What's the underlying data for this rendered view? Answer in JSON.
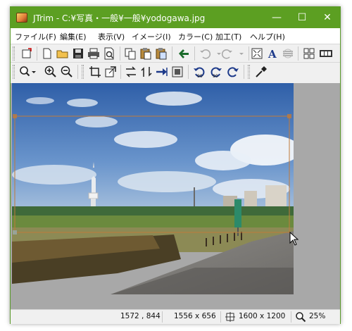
{
  "window": {
    "title": "JTrim - C:¥写真・一般¥一般¥yodogawa.jpg",
    "accent_color": "#5c9f22"
  },
  "title_controls": {
    "minimize": "—",
    "maximize": "☐",
    "close": "✕"
  },
  "menu": [
    "ファイル(F)",
    "編集(E)",
    "表示(V)",
    "イメージ(I)",
    "カラー(C)",
    "加工(T)",
    "ヘルプ(H)"
  ],
  "toolbar1_icons": [
    "select-icon",
    "new-file-icon",
    "open-folder-icon",
    "save-icon",
    "print-icon",
    "print-preview-icon",
    "copy-icon",
    "paste-icon",
    "paste-new-icon",
    "capture-icon",
    "undo-icon",
    "redo-icon",
    "fit-window-icon",
    "text-icon",
    "wave-icon",
    "thumbnail-grid-icon",
    "filmstrip-icon"
  ],
  "toolbar2_icons": [
    "zoom-dropdown-icon",
    "zoom-in-icon",
    "zoom-out-icon",
    "crop-icon",
    "resize-icon",
    "flip-horizontal-icon",
    "flip-vertical-icon",
    "arrow-right-icon",
    "frame-icon",
    "rotate-left-90-icon",
    "rotate-right-90-icon",
    "rotate-free-icon",
    "eyedropper-icon"
  ],
  "status": {
    "cursor_pos": "1572 , 844",
    "selection_size": "1556 x 656",
    "image_size": "1600 x 1200",
    "zoom": "25%"
  }
}
